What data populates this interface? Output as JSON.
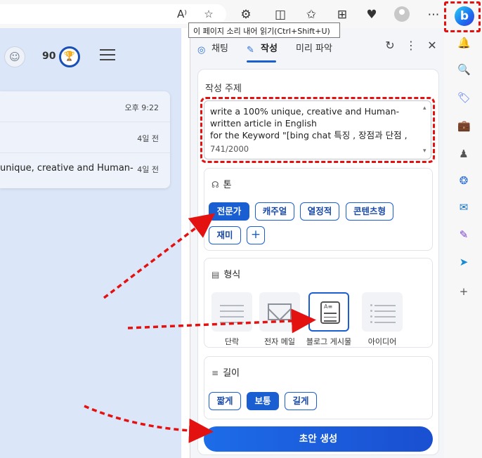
{
  "browser": {
    "tooltip": "이 페이지 소리 내어 읽기(Ctrl+Shift+U)",
    "read_aloud_icon": "A⁾",
    "bing_logo": "b"
  },
  "left_page": {
    "points": "90",
    "history": [
      {
        "title": "",
        "time": "오후 9:22"
      },
      {
        "title": "",
        "time": "4일 전"
      },
      {
        "title": "unique, creative and Human-w",
        "time": "4일 전"
      }
    ]
  },
  "panel": {
    "tabs": [
      {
        "label": "채팅",
        "active": false
      },
      {
        "label": "작성",
        "active": true
      },
      {
        "label": "미리 파악",
        "active": false
      }
    ],
    "topic_label": "작성 주제",
    "topic_lines": [
      "write a 100% unique, creative and Human-",
      "written article in English",
      "for the Keyword \"[bing chat 특징 , 장점과 단점 ,"
    ],
    "char_count": "741/2000",
    "tone": {
      "label": "톤",
      "options": [
        "전문가",
        "캐주얼",
        "열정적",
        "콘텐츠형",
        "재미"
      ],
      "selected": "전문가",
      "add_label": "+"
    },
    "format": {
      "label": "형식",
      "options": [
        "단락",
        "전자 메일",
        "블로그 게시물",
        "아이디어"
      ],
      "selected": "블로그 게시물"
    },
    "length": {
      "label": "길이",
      "options": [
        "짧게",
        "보통",
        "길게"
      ],
      "selected": "보통"
    },
    "generate_label": "초안 생성"
  },
  "colors": {
    "accent": "#1a5fd1",
    "annotation_red": "#e41111"
  }
}
